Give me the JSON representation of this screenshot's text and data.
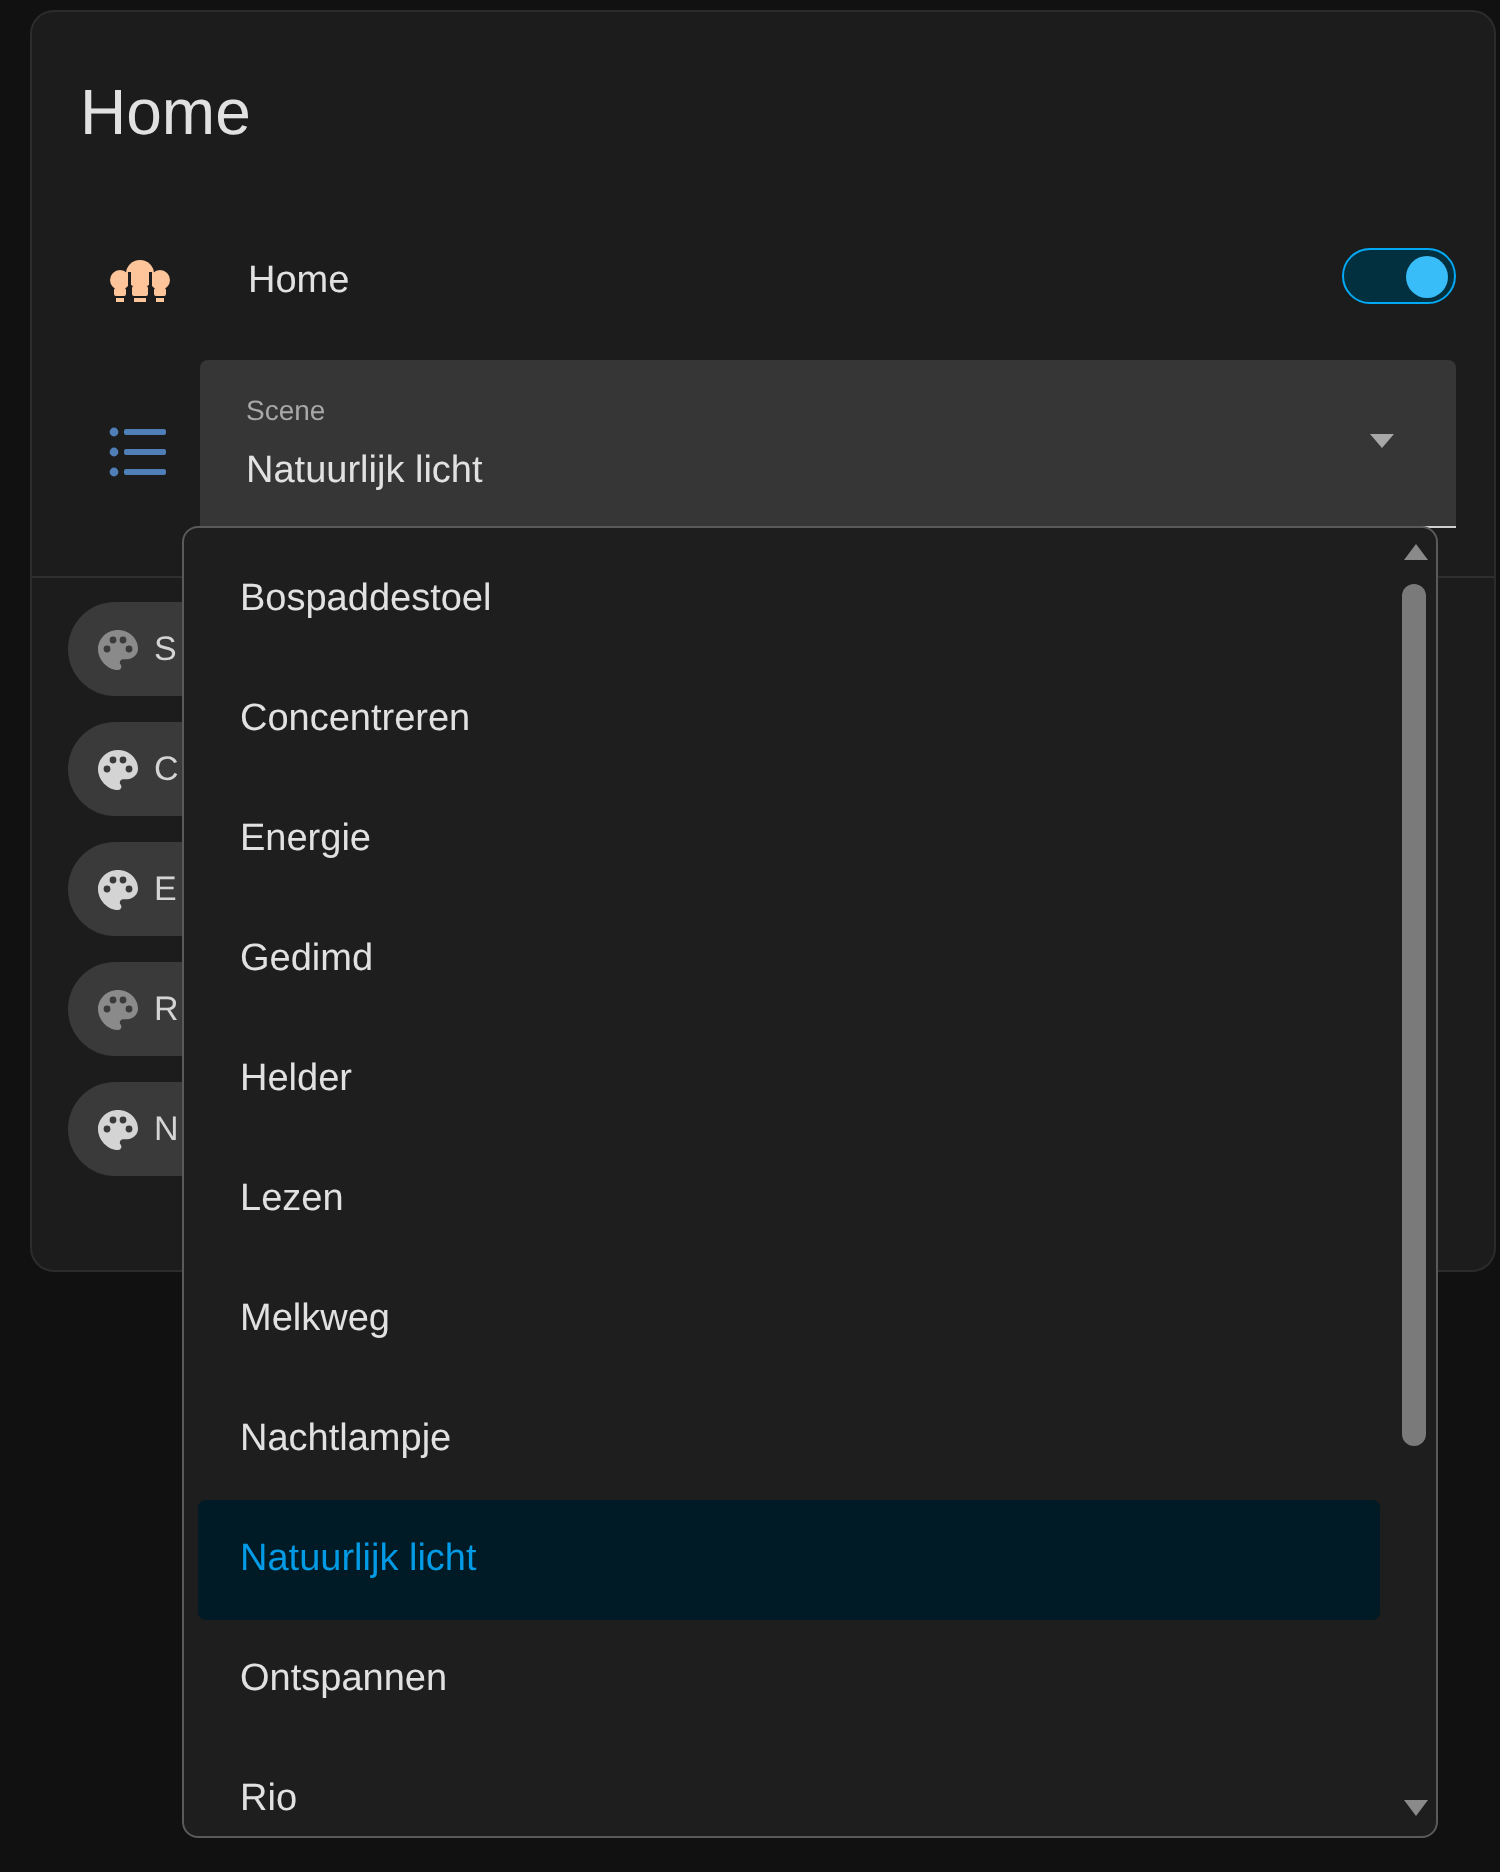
{
  "card": {
    "title": "Home"
  },
  "toggle_row": {
    "label": "Home",
    "on": true
  },
  "select": {
    "label": "Scene",
    "value": "Natuurlijk licht",
    "expanded": true
  },
  "chips": [
    {
      "label": "S",
      "on": false
    },
    {
      "label": "C",
      "on": true
    },
    {
      "label": "E",
      "on": true
    },
    {
      "label": "R",
      "on": false
    },
    {
      "label": "N",
      "on": true
    }
  ],
  "menu": {
    "items": [
      {
        "label": "Bospaddestoel",
        "selected": false
      },
      {
        "label": "Concentreren",
        "selected": false
      },
      {
        "label": "Energie",
        "selected": false
      },
      {
        "label": "Gedimd",
        "selected": false
      },
      {
        "label": "Helder",
        "selected": false
      },
      {
        "label": "Lezen",
        "selected": false
      },
      {
        "label": "Melkweg",
        "selected": false
      },
      {
        "label": "Nachtlampje",
        "selected": false
      },
      {
        "label": "Natuurlijk licht",
        "selected": true
      },
      {
        "label": "Ontspannen",
        "selected": false
      },
      {
        "label": "Rio",
        "selected": false
      }
    ]
  }
}
